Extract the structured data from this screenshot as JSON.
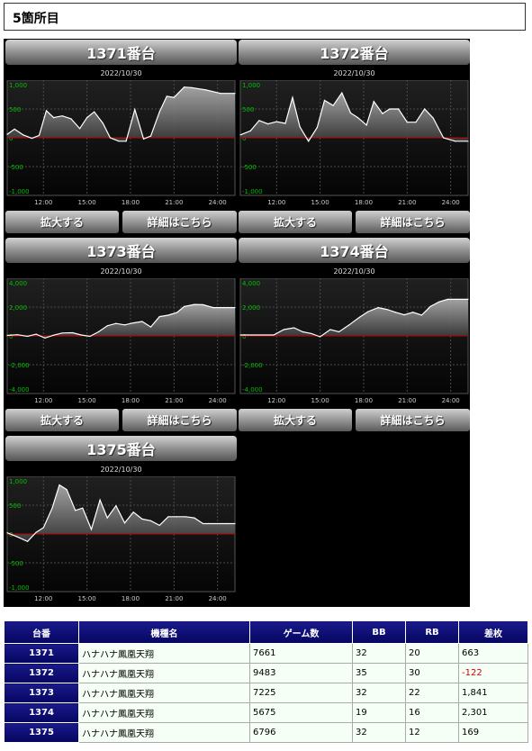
{
  "header": {
    "title": "5箇所目"
  },
  "buttons": {
    "zoom": "拡大する",
    "detail": "詳細はこちら"
  },
  "colors": {
    "panel_bg": "#000000",
    "zero_line": "#c00000",
    "tick_label": "#00c000",
    "series": "#ffffff"
  },
  "charts": [
    {
      "title": "1371番台",
      "date": "2022/10/30",
      "y_ticks": [
        "1,000",
        "500",
        "0",
        "-500",
        "-1,000"
      ],
      "x_ticks": [
        "12:00",
        "15:00",
        "18:00",
        "21:00",
        "24:00"
      ],
      "chart_data": {
        "type": "area",
        "ylim": [
          -1000,
          1000
        ],
        "y_tick_values": [
          1000,
          500,
          0,
          -500,
          -1000
        ],
        "x_tick_values": [
          12,
          15,
          18,
          21,
          24
        ],
        "xlim": [
          9.5,
          25.2
        ],
        "x": [
          9.5,
          10,
          10.6,
          11.2,
          11.7,
          12.2,
          12.7,
          13.3,
          13.9,
          14.5,
          15,
          15.5,
          16.1,
          16.6,
          17.2,
          17.7,
          18.3,
          18.9,
          19.4,
          20,
          20.5,
          21,
          21.7,
          22.2,
          23.2,
          24.2,
          25.2
        ],
        "values": [
          60,
          150,
          50,
          -10,
          40,
          470,
          350,
          380,
          330,
          160,
          350,
          450,
          250,
          0,
          -60,
          -60,
          490,
          -20,
          30,
          450,
          720,
          700,
          880,
          870,
          830,
          770,
          770
        ]
      }
    },
    {
      "title": "1372番台",
      "date": "2022/10/30",
      "y_ticks": [
        "1,000",
        "500",
        "0",
        "-500",
        "-1,000"
      ],
      "x_ticks": [
        "12:00",
        "15:00",
        "18:00",
        "21:00",
        "24:00"
      ],
      "chart_data": {
        "type": "area",
        "ylim": [
          -1000,
          1000
        ],
        "y_tick_values": [
          1000,
          500,
          0,
          -500,
          -1000
        ],
        "x_tick_values": [
          12,
          15,
          18,
          21,
          24
        ],
        "xlim": [
          9.5,
          25.2
        ],
        "x": [
          9.5,
          10.2,
          10.8,
          11.4,
          12,
          12.6,
          13.1,
          13.6,
          14.2,
          14.8,
          15.3,
          15.9,
          16.5,
          17.1,
          17.6,
          18.2,
          18.7,
          19.3,
          19.8,
          20.4,
          21,
          21.6,
          22.2,
          22.8,
          23.5,
          24.3,
          25.2
        ],
        "values": [
          50,
          120,
          300,
          240,
          280,
          250,
          700,
          190,
          -60,
          180,
          650,
          560,
          780,
          430,
          350,
          220,
          630,
          420,
          500,
          500,
          270,
          270,
          500,
          340,
          0,
          -60,
          -60
        ]
      }
    },
    {
      "title": "1373番台",
      "date": "2022/10/30",
      "y_ticks": [
        "4,000",
        "2,000",
        "0",
        "-2,000",
        "-4,000"
      ],
      "x_ticks": [
        "12:00",
        "15:00",
        "18:00",
        "21:00",
        "24:00"
      ],
      "chart_data": {
        "type": "area",
        "ylim": [
          -4000,
          4000
        ],
        "y_tick_values": [
          4000,
          2000,
          0,
          -2000,
          -4000
        ],
        "x_tick_values": [
          12,
          15,
          18,
          21,
          24
        ],
        "xlim": [
          9.5,
          25.2
        ],
        "x": [
          9.5,
          10.2,
          10.9,
          11.5,
          12.1,
          12.7,
          13.3,
          14,
          14.6,
          15.2,
          15.8,
          16.4,
          17,
          17.6,
          18.2,
          18.8,
          19.4,
          20,
          20.6,
          21.2,
          21.7,
          22.4,
          23,
          23.7,
          24.4,
          25.2
        ],
        "values": [
          30,
          80,
          -30,
          120,
          -150,
          50,
          200,
          220,
          60,
          -30,
          280,
          700,
          860,
          760,
          900,
          1000,
          620,
          1340,
          1440,
          1620,
          2040,
          2180,
          2160,
          1960,
          1960,
          1960
        ]
      }
    },
    {
      "title": "1374番台",
      "date": "2022/10/30",
      "y_ticks": [
        "4,000",
        "2,000",
        "0",
        "-2,000",
        "-4,000"
      ],
      "x_ticks": [
        "12:00",
        "15:00",
        "18:00",
        "21:00",
        "24:00"
      ],
      "chart_data": {
        "type": "area",
        "ylim": [
          -4000,
          4000
        ],
        "y_tick_values": [
          4000,
          2000,
          0,
          -2000,
          -4000
        ],
        "x_tick_values": [
          12,
          15,
          18,
          21,
          24
        ],
        "xlim": [
          9.5,
          25.2
        ],
        "x": [
          9.5,
          10.3,
          11.1,
          11.8,
          12.5,
          13.2,
          13.8,
          14.4,
          15,
          15.7,
          16.3,
          17,
          17.7,
          18.3,
          19,
          19.6,
          20.2,
          20.8,
          21.4,
          22,
          22.6,
          23.2,
          23.8,
          24.4,
          25.2
        ],
        "values": [
          60,
          60,
          60,
          60,
          440,
          560,
          280,
          160,
          -60,
          440,
          280,
          760,
          1280,
          1680,
          1960,
          1840,
          1640,
          1460,
          1640,
          1440,
          2040,
          2360,
          2540,
          2540,
          2540
        ]
      }
    },
    {
      "title": "1375番台",
      "date": "2022/10/30",
      "y_ticks": [
        "1,000",
        "500",
        "0",
        "-500",
        "-1,000"
      ],
      "x_ticks": [
        "12:00",
        "15:00",
        "18:00",
        "21:00",
        "24:00"
      ],
      "chart_data": {
        "type": "area",
        "ylim": [
          -1000,
          1000
        ],
        "y_tick_values": [
          1000,
          500,
          0,
          -500,
          -1000
        ],
        "x_tick_values": [
          12,
          15,
          18,
          21,
          24
        ],
        "xlim": [
          9.5,
          25.2
        ],
        "x": [
          9.5,
          10.2,
          10.9,
          11.5,
          12,
          12.6,
          13.1,
          13.6,
          14.2,
          14.7,
          15.3,
          15.9,
          16.4,
          17.0,
          17.6,
          18.2,
          18.8,
          19.4,
          20.0,
          20.6,
          21.2,
          21.8,
          22.4,
          23.0,
          23.8,
          24.6,
          25.2
        ],
        "values": [
          20,
          -50,
          -130,
          30,
          110,
          450,
          850,
          770,
          410,
          450,
          80,
          590,
          280,
          490,
          190,
          380,
          260,
          230,
          150,
          300,
          300,
          300,
          280,
          180,
          180,
          180,
          180
        ]
      }
    }
  ],
  "table": {
    "headers": [
      "台番",
      "機種名",
      "ゲーム数",
      "BB",
      "RB",
      "差枚"
    ],
    "rows": [
      {
        "number": "1371",
        "machine": "ハナハナ鳳凰天翔",
        "games": "7661",
        "bb": "32",
        "rb": "20",
        "diff": "663"
      },
      {
        "number": "1372",
        "machine": "ハナハナ鳳凰天翔",
        "games": "9483",
        "bb": "35",
        "rb": "30",
        "diff": "-122"
      },
      {
        "number": "1373",
        "machine": "ハナハナ鳳凰天翔",
        "games": "7225",
        "bb": "32",
        "rb": "22",
        "diff": "1,841"
      },
      {
        "number": "1374",
        "machine": "ハナハナ鳳凰天翔",
        "games": "5675",
        "bb": "19",
        "rb": "16",
        "diff": "2,301"
      },
      {
        "number": "1375",
        "machine": "ハナハナ鳳凰天翔",
        "games": "6796",
        "bb": "32",
        "rb": "12",
        "diff": "169"
      }
    ]
  }
}
